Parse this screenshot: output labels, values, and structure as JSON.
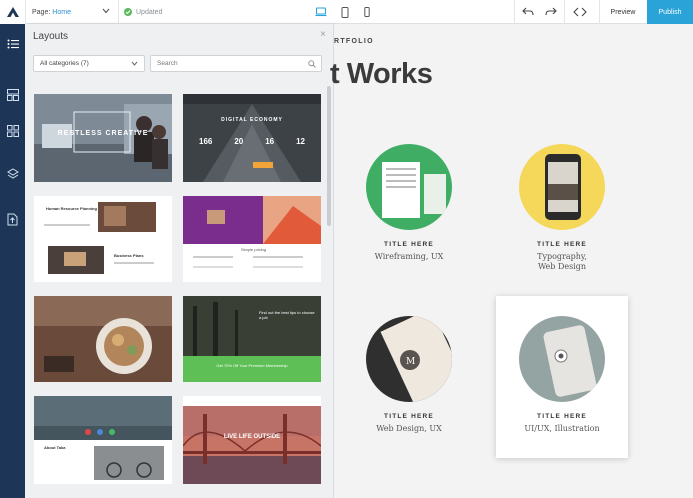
{
  "topbar": {
    "page_label": "Page:",
    "page_value": "Home",
    "status": "Updated",
    "preview": "Preview",
    "publish": "Publish",
    "icons": [
      "logo-icon",
      "chevron-down-icon",
      "check-icon",
      "desktop-icon",
      "tablet-icon",
      "mobile-icon",
      "undo-icon",
      "redo-icon",
      "code-icon"
    ]
  },
  "rail": {
    "items": [
      "list-icon",
      "layouts-icon",
      "grid-icon",
      "layers-icon",
      "export-icon"
    ]
  },
  "panel": {
    "title": "Layouts",
    "close": "×",
    "category": "All categories (7)",
    "search_placeholder": "Search",
    "thumbnails": [
      {
        "name": "office",
        "caption": "RESTLESS CREATIVE"
      },
      {
        "name": "digital-economy",
        "caption": "DIGITAL ECONOMY",
        "stats": [
          "166",
          "20",
          "16",
          "12"
        ]
      },
      {
        "name": "human-resource",
        "caption": "Human Resource Planning",
        "sub": "Business Plans"
      },
      {
        "name": "purple-hero",
        "caption": "Simple pricing"
      },
      {
        "name": "food",
        "caption": ""
      },
      {
        "name": "forest",
        "caption": "Find out the best tips to choose a job",
        "banner": "Get 70% Off Your Premium Membership"
      },
      {
        "name": "bicycle",
        "caption": "About Taka"
      },
      {
        "name": "bridge",
        "caption": "LIVE LIFE OUTSIDE"
      }
    ]
  },
  "canvas": {
    "eyebrow": "RTFOLIO",
    "heading": "t Works",
    "cards": [
      {
        "title": "TITLE HERE",
        "sub1": "Wireframing, UX",
        "sub2": "",
        "color": "#3fae64"
      },
      {
        "title": "TITLE HERE",
        "sub1": "Typography,",
        "sub2": "Web Design",
        "color": "#f5d75a"
      },
      {
        "title": "TITLE HERE",
        "sub1": "Web Design, UX",
        "sub2": "",
        "color": "#2f2f2f"
      },
      {
        "title": "TITLE HERE",
        "sub1": "UI/UX, Illustration",
        "sub2": "",
        "color": "#93a4a3"
      }
    ]
  },
  "colors": {
    "accent": "#2aa3d8",
    "rail": "#1d3557",
    "success": "#5cb85c"
  }
}
